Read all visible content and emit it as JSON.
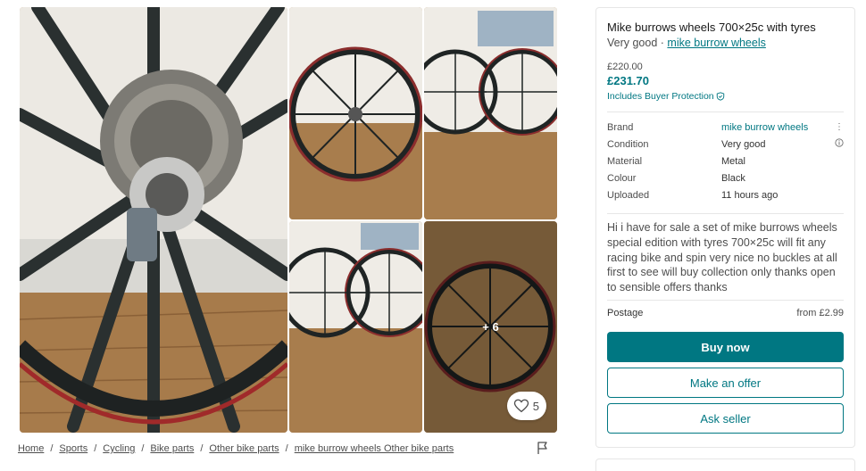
{
  "gallery": {
    "more_photos_label": "+ 6",
    "favourite_count": "5"
  },
  "breadcrumb": {
    "items": [
      "Home",
      "Sports",
      "Cycling",
      "Bike parts",
      "Other bike parts",
      "mike burrow wheels Other bike parts"
    ],
    "separator": "/"
  },
  "item": {
    "title": "Mike burrows wheels 700×25c with tyres",
    "condition": "Very good",
    "subtitle_separator": " · ",
    "brand_link": "mike burrow wheels",
    "price_original": "£220.00",
    "price_total": "£231.70",
    "buyer_protection": "Includes Buyer Protection",
    "details": [
      {
        "label": "Brand",
        "value": "mike burrow wheels",
        "link": true,
        "side_icon": "more-vertical-icon"
      },
      {
        "label": "Condition",
        "value": "Very good",
        "link": false,
        "side_icon": "info-icon"
      },
      {
        "label": "Material",
        "value": "Metal",
        "link": false
      },
      {
        "label": "Colour",
        "value": "Black",
        "link": false
      },
      {
        "label": "Uploaded",
        "value": "11 hours ago",
        "link": false
      }
    ],
    "description": "Hi i have for sale a set of mike burrows wheels special edition with tyres 700×25c will fit any racing bike and spin very nice no buckles at all first to see will buy collection only thanks open to sensible offers thanks",
    "postage_label": "Postage",
    "postage_value": "from £2.99"
  },
  "actions": {
    "buy_now": "Buy now",
    "make_offer": "Make an offer",
    "ask_seller": "Ask seller"
  },
  "colors": {
    "accent": "#007782",
    "text_primary": "#171717",
    "text_secondary": "#4d4d4d",
    "border": "#e6e6e6"
  }
}
